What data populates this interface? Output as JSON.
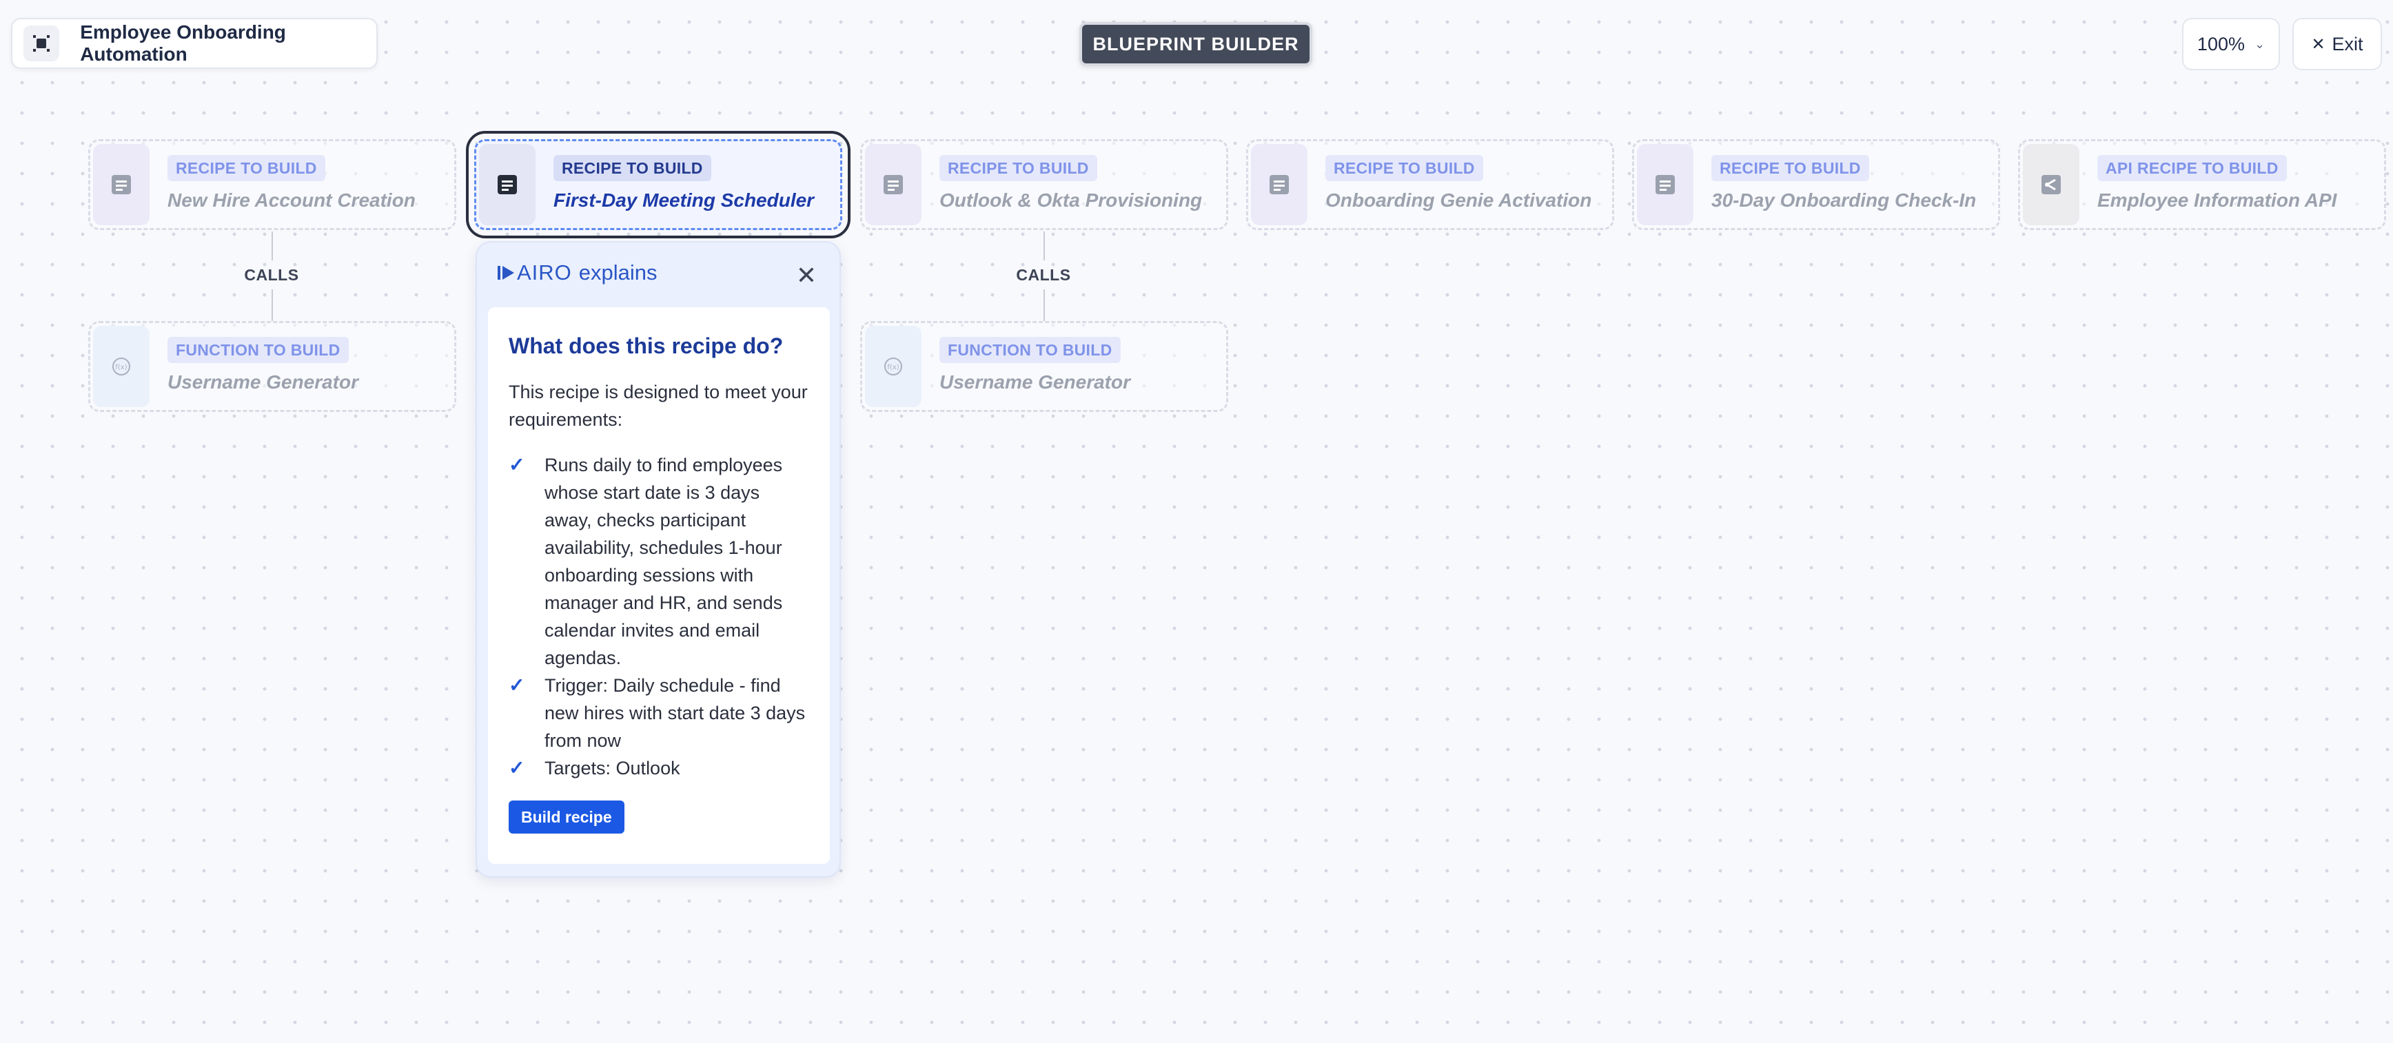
{
  "header": {
    "project_title": "Employee Onboarding Automation",
    "mode_label": "BLUEPRINT BUILDER",
    "zoom_value": "100%",
    "exit_label": "Exit"
  },
  "nodes": [
    {
      "chip": "RECIPE TO BUILD",
      "name": "New Hire Account Creation",
      "icon": "recipe-icon"
    },
    {
      "chip": "RECIPE TO BUILD",
      "name": "First-Day Meeting Scheduler",
      "icon": "recipe-icon",
      "selected": true
    },
    {
      "chip": "RECIPE TO BUILD",
      "name": "Outlook & Okta Provisioning",
      "icon": "recipe-icon"
    },
    {
      "chip": "RECIPE TO BUILD",
      "name": "Onboarding Genie Activation",
      "icon": "recipe-icon"
    },
    {
      "chip": "RECIPE TO BUILD",
      "name": "30-Day Onboarding Check-In",
      "icon": "recipe-icon"
    },
    {
      "chip": "API RECIPE TO BUILD",
      "name": "Employee Information API",
      "icon": "api-icon"
    }
  ],
  "functions": [
    {
      "chip": "FUNCTION TO BUILD",
      "name": "Username Generator",
      "icon": "function-icon"
    },
    {
      "chip": "FUNCTION TO BUILD",
      "name": "Username Generator",
      "icon": "function-icon"
    }
  ],
  "connectors": {
    "calls_label": "CALLS"
  },
  "popover": {
    "brand": "AIRO",
    "brand_suffix": "explains",
    "heading": "What does this recipe do?",
    "intro": "This recipe is designed to meet your requirements:",
    "items": [
      "Runs daily to find employees whose start date is 3 days away, checks participant availability, schedules 1-hour onboarding sessions with manager and HR, and sends calendar invites and email agendas.",
      "Trigger: Daily schedule - find new hires with start date 3 days from now",
      "Targets: Outlook"
    ],
    "build_label": "Build recipe"
  },
  "colors": {
    "accent": "#1b59e4",
    "brand_blue": "#2a56c6",
    "mode_badge": "#434a59"
  }
}
